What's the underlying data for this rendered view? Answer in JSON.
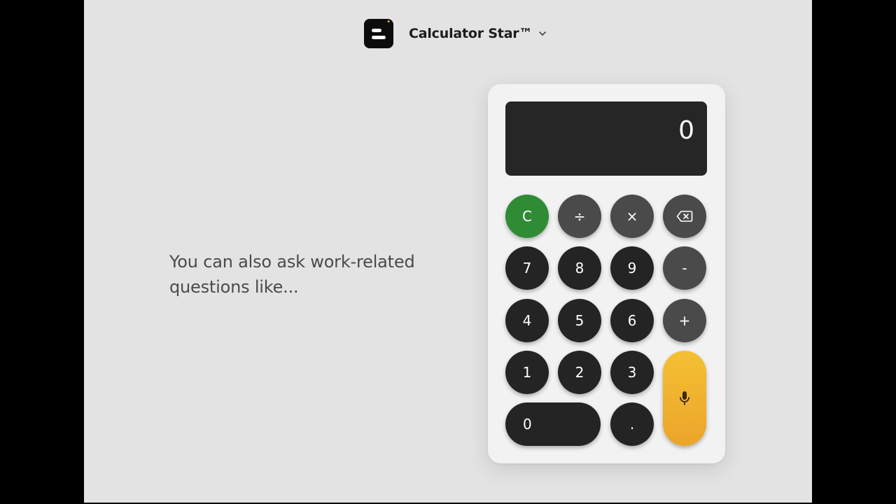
{
  "header": {
    "title": "Calculator Star™",
    "logo_icon": "menu-lines-icon"
  },
  "prompt": {
    "line1": "You can also ask work-related",
    "line2": "questions like..."
  },
  "calculator": {
    "display_value": "0",
    "keys": {
      "clear": "C",
      "divide": "÷",
      "multiply": "×",
      "backspace_icon": "backspace-icon",
      "seven": "7",
      "eight": "8",
      "nine": "9",
      "minus": "-",
      "four": "4",
      "five": "5",
      "six": "6",
      "plus": "+",
      "one": "1",
      "two": "2",
      "three": "3",
      "mic_icon": "microphone-icon",
      "zero": "0",
      "decimal": "."
    }
  },
  "colors": {
    "background": "#e3e3e3",
    "clear_key": "#2f8b34",
    "number_key": "#242424",
    "operator_key": "#4a4a4a",
    "mic_key": "#f0b22e",
    "display": "#262626"
  }
}
